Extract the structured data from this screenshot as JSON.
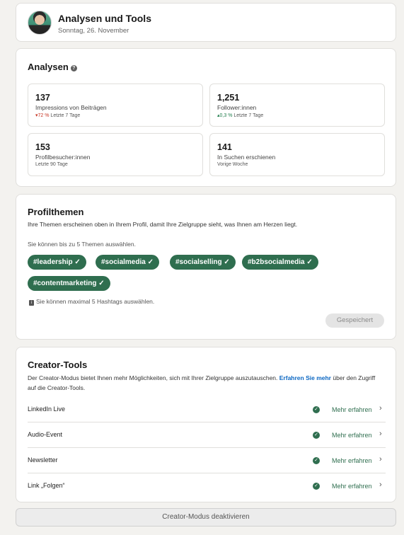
{
  "header": {
    "title": "Analysen und Tools",
    "date": "Sonntag, 26. November"
  },
  "analytics": {
    "title": "Analysen",
    "help_icon": "?",
    "metrics": [
      {
        "value": "137",
        "label": "Impressions von Beiträgen",
        "change": "▾72 %",
        "period": "Letzte 7 Tage",
        "trend": "down"
      },
      {
        "value": "1,251",
        "label": "Follower:innen",
        "change": "▴0,3 %",
        "period": "Letzte 7 Tage",
        "trend": "up"
      },
      {
        "value": "153",
        "label": "Profilbesucher:innen",
        "period": "Letzte 90 Tage"
      },
      {
        "value": "141",
        "label": "In Suchen erschienen",
        "period": "Vorige Woche"
      }
    ]
  },
  "topics": {
    "title": "Profilthemen",
    "description": "Ihre Themen erscheinen oben in Ihrem Profil, damit Ihre Zielgruppe sieht, was Ihnen am Herzen liegt.",
    "limit_hint": "Sie können bis zu 5 Themen auswählen.",
    "chips": [
      "#leadership ✓",
      "#socialmedia ✓",
      "#socialselling ✓",
      "#b2bsocialmedia ✓",
      "#contentmarketing ✓"
    ],
    "info_icon": "i",
    "info_text": "Sie können maximal 5 Hashtags auswählen.",
    "saved_label": "Gespeichert"
  },
  "creator": {
    "title": "Creator-Tools",
    "description_before": "Der Creator-Modus bietet Ihnen mehr Möglichkeiten, sich mit Ihrer Zielgruppe auszutauschen. ",
    "link_text": "Erfahren Sie mehr",
    "description_after": " über den Zugriff auf die Creator-Tools.",
    "tools": [
      {
        "name": "LinkedIn Live",
        "action": "Mehr erfahren"
      },
      {
        "name": "Audio-Event",
        "action": "Mehr erfahren"
      },
      {
        "name": "Newsletter",
        "action": "Mehr erfahren"
      },
      {
        "name": "Link „Folgen“",
        "action": "Mehr erfahren"
      }
    ],
    "check_glyph": "✓",
    "chevron_glyph": "›"
  },
  "deactivate_label": "Creator-Modus deaktivieren"
}
